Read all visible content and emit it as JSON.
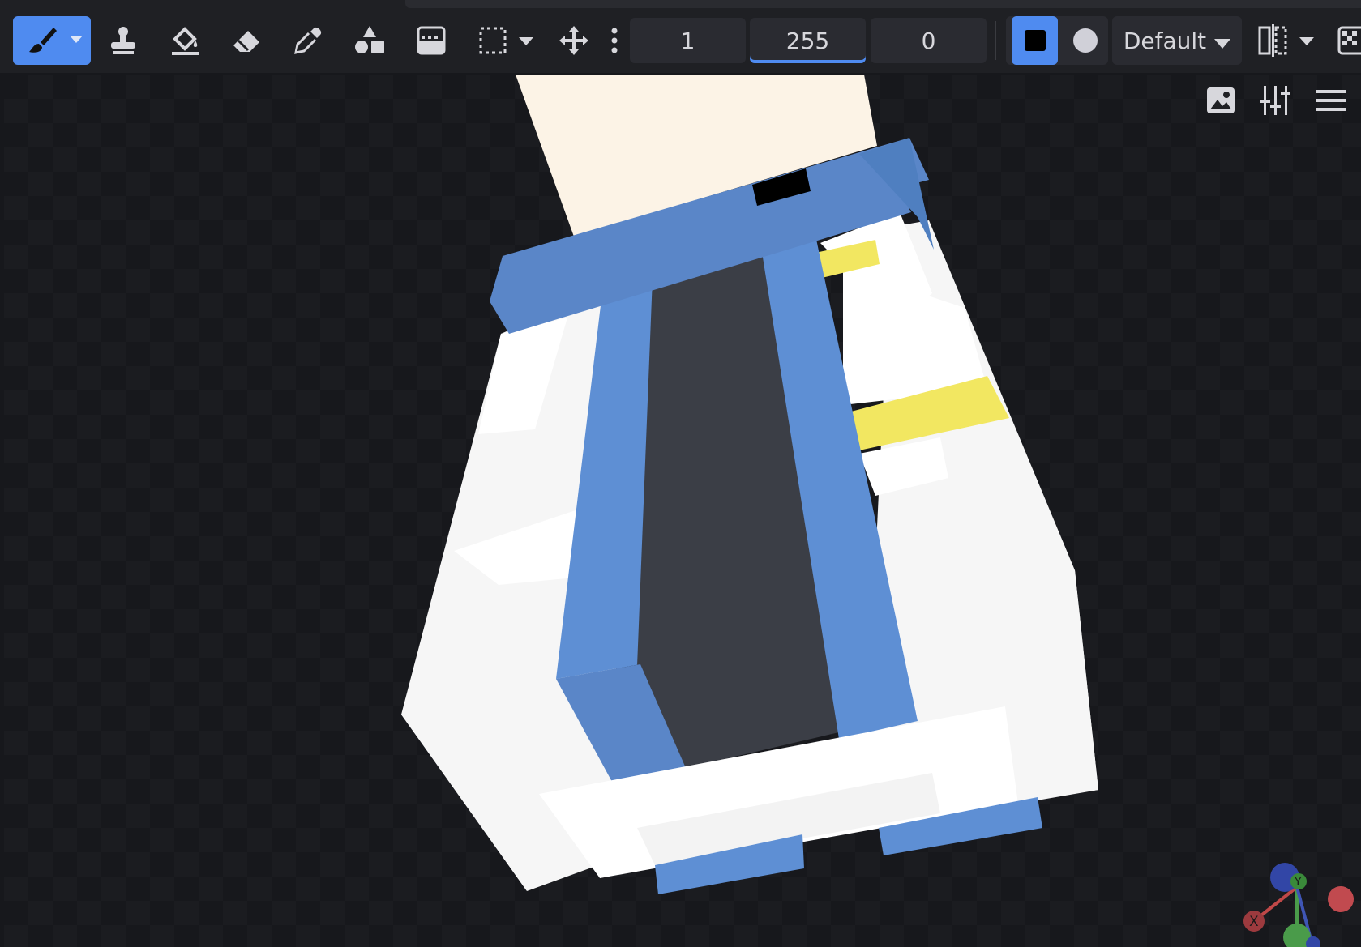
{
  "toolbar": {
    "tools": [
      {
        "name": "brush",
        "icon": "brush-icon",
        "active": true
      },
      {
        "name": "clone-stamp",
        "icon": "stamp-icon"
      },
      {
        "name": "fill-bucket",
        "icon": "bucket-icon"
      },
      {
        "name": "eraser",
        "icon": "eraser-icon"
      },
      {
        "name": "color-picker",
        "icon": "eyedropper-icon"
      },
      {
        "name": "shapes",
        "icon": "shapes-icon"
      },
      {
        "name": "gradient",
        "icon": "gradient-icon"
      },
      {
        "name": "selection",
        "icon": "selection-icon"
      },
      {
        "name": "move",
        "icon": "move-icon"
      }
    ],
    "fields": {
      "brush_size": "1",
      "opacity": "255",
      "softness": "0"
    },
    "blend_mode": "Default",
    "colors": {
      "primary": "#000000",
      "secondary": "#d0d0d8",
      "accent": "#4f8bf0"
    }
  },
  "viewport": {
    "icons": [
      "image-icon",
      "sliders-icon",
      "menu-icon"
    ],
    "gizmo_axes": [
      "X",
      "Y",
      "Z"
    ]
  }
}
